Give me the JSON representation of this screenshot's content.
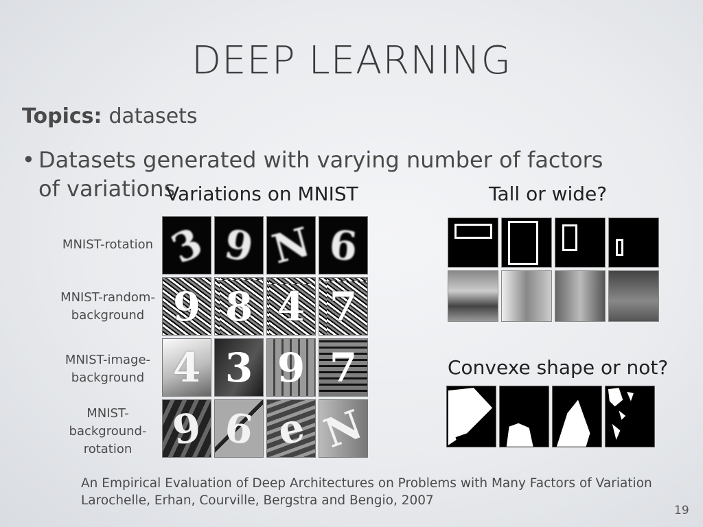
{
  "slide": {
    "title": "DEEP LEARNING",
    "topics_label": "Topics:",
    "topics_value": "datasets",
    "bullet_symbol": "•",
    "bullet_text": "Datasets generated with varying number of factors of variations",
    "page_number": "19"
  },
  "mnist": {
    "heading": "Variations on MNIST",
    "rows": [
      {
        "label": "MNIST-rotation",
        "digits": [
          "3",
          "9",
          "N",
          "6"
        ]
      },
      {
        "label": "MNIST-random-\nbackground",
        "digits": [
          "9",
          "8",
          "4",
          "7"
        ]
      },
      {
        "label": "MNIST-image-\nbackground",
        "digits": [
          "4",
          "3",
          "9",
          "7"
        ]
      },
      {
        "label": "MNIST-\nbackground-\nrotation",
        "digits": [
          "9",
          "6",
          "e",
          "N"
        ]
      }
    ]
  },
  "tall_wide": {
    "heading": "Tall or wide?"
  },
  "convex": {
    "heading": "Convexe shape or not?"
  },
  "citation": {
    "line1": "An Empirical Evaluation of Deep Architectures on Problems with Many Factors of Variation",
    "line2": "Larochelle, Erhan, Courville, Bergstra and Bengio, 2007"
  }
}
